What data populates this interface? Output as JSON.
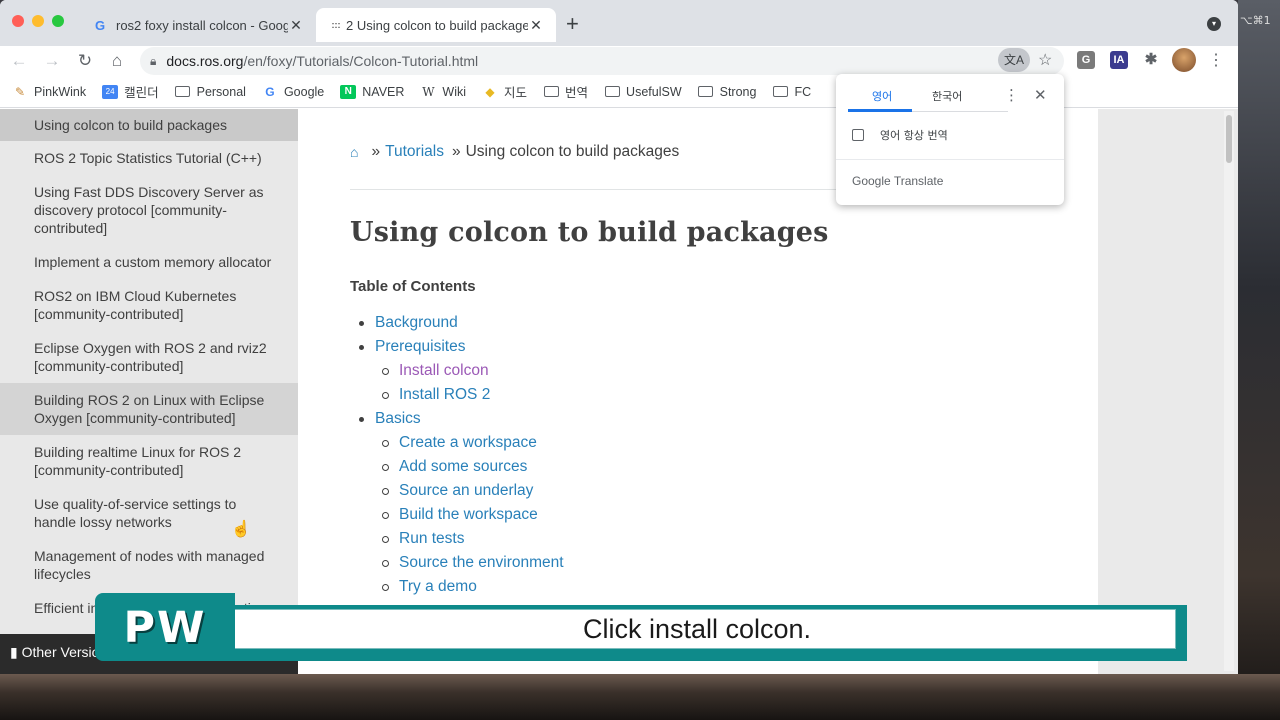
{
  "desktop": {
    "menu_text": "⌥⌘1"
  },
  "browser": {
    "tabs": [
      {
        "favicon": "G",
        "title": "ros2 foxy install colcon - Goog",
        "active": false
      },
      {
        "favicon": ":::",
        "title": "2  Using colcon to build packages",
        "active": true
      }
    ],
    "url_host": "docs.ros.org",
    "url_path": "/en/foxy/Tutorials/Colcon-Tutorial.html",
    "extensions": [
      "G",
      "IA"
    ],
    "bookmarks": [
      {
        "icon": "pinkwink-icon",
        "label": "PinkWink"
      },
      {
        "icon": "calendar-icon",
        "label": "캘린더"
      },
      {
        "icon": "folder-icon",
        "label": "Personal"
      },
      {
        "icon": "google-icon",
        "label": "Google"
      },
      {
        "icon": "naver-icon",
        "label": "NAVER"
      },
      {
        "icon": "wiki-icon",
        "label": "Wiki"
      },
      {
        "icon": "map-pin-icon",
        "label": "지도"
      },
      {
        "icon": "folder-icon",
        "label": "번역"
      },
      {
        "icon": "folder-icon",
        "label": "UsefulSW"
      },
      {
        "icon": "folder-icon",
        "label": "Strong"
      },
      {
        "icon": "folder-icon",
        "label": "FC"
      }
    ]
  },
  "sidebar": {
    "items": [
      {
        "label": "Using colcon to build packages",
        "state": "current"
      },
      {
        "label": "ROS 2 Topic Statistics Tutorial (C++)",
        "state": ""
      },
      {
        "label": "Using Fast DDS Discovery Server as discovery protocol [community-contributed]",
        "state": ""
      },
      {
        "label": "Implement a custom memory allocator",
        "state": ""
      },
      {
        "label": "ROS2 on IBM Cloud Kubernetes [community-contributed]",
        "state": ""
      },
      {
        "label": "Eclipse Oxygen with ROS 2 and rviz2 [community-contributed]",
        "state": ""
      },
      {
        "label": "Building ROS 2 on Linux with Eclipse Oxygen [community-contributed]",
        "state": "hover"
      },
      {
        "label": "Building realtime Linux for ROS 2 [community-contributed]",
        "state": ""
      },
      {
        "label": "Use quality-of-service settings to handle lossy networks",
        "state": ""
      },
      {
        "label": "Management of nodes with managed lifecycles",
        "state": ""
      },
      {
        "label": "Efficient intra-process communication",
        "state": ""
      }
    ],
    "footer": "Other Versions"
  },
  "content": {
    "breadcrumb_link": "Tutorials",
    "breadcrumb_current": "Using colcon to build packages",
    "title": "Using colcon to build packages",
    "toc_title": "Table of Contents",
    "toc": [
      {
        "label": "Background",
        "level": 1,
        "visited": false
      },
      {
        "label": "Prerequisites",
        "level": 1,
        "visited": false
      },
      {
        "label": "Install colcon",
        "level": 2,
        "visited": true
      },
      {
        "label": "Install ROS 2",
        "level": 2,
        "visited": false
      },
      {
        "label": "Basics",
        "level": 1,
        "visited": false
      },
      {
        "label": "Create a workspace",
        "level": 2,
        "visited": false
      },
      {
        "label": "Add some sources",
        "level": 2,
        "visited": false
      },
      {
        "label": "Source an underlay",
        "level": 2,
        "visited": false
      },
      {
        "label": "Build the workspace",
        "level": 2,
        "visited": false
      },
      {
        "label": "Run tests",
        "level": 2,
        "visited": false
      },
      {
        "label": "Source the environment",
        "level": 2,
        "visited": false
      },
      {
        "label": "Try a demo",
        "level": 2,
        "visited": false
      }
    ]
  },
  "translate_popup": {
    "tab_source": "영어",
    "tab_target": "한국어",
    "always_translate_label": "영어 항상 번역",
    "footer_brand": "Google",
    "footer_product": "Translate"
  },
  "overlay": {
    "badge": "PW",
    "caption": "Click install colcon."
  },
  "colors": {
    "link": "#2980b9",
    "visited_link": "#9b59b6",
    "caption_teal": "#0e8a8a",
    "translate_accent": "#1a73e8"
  }
}
